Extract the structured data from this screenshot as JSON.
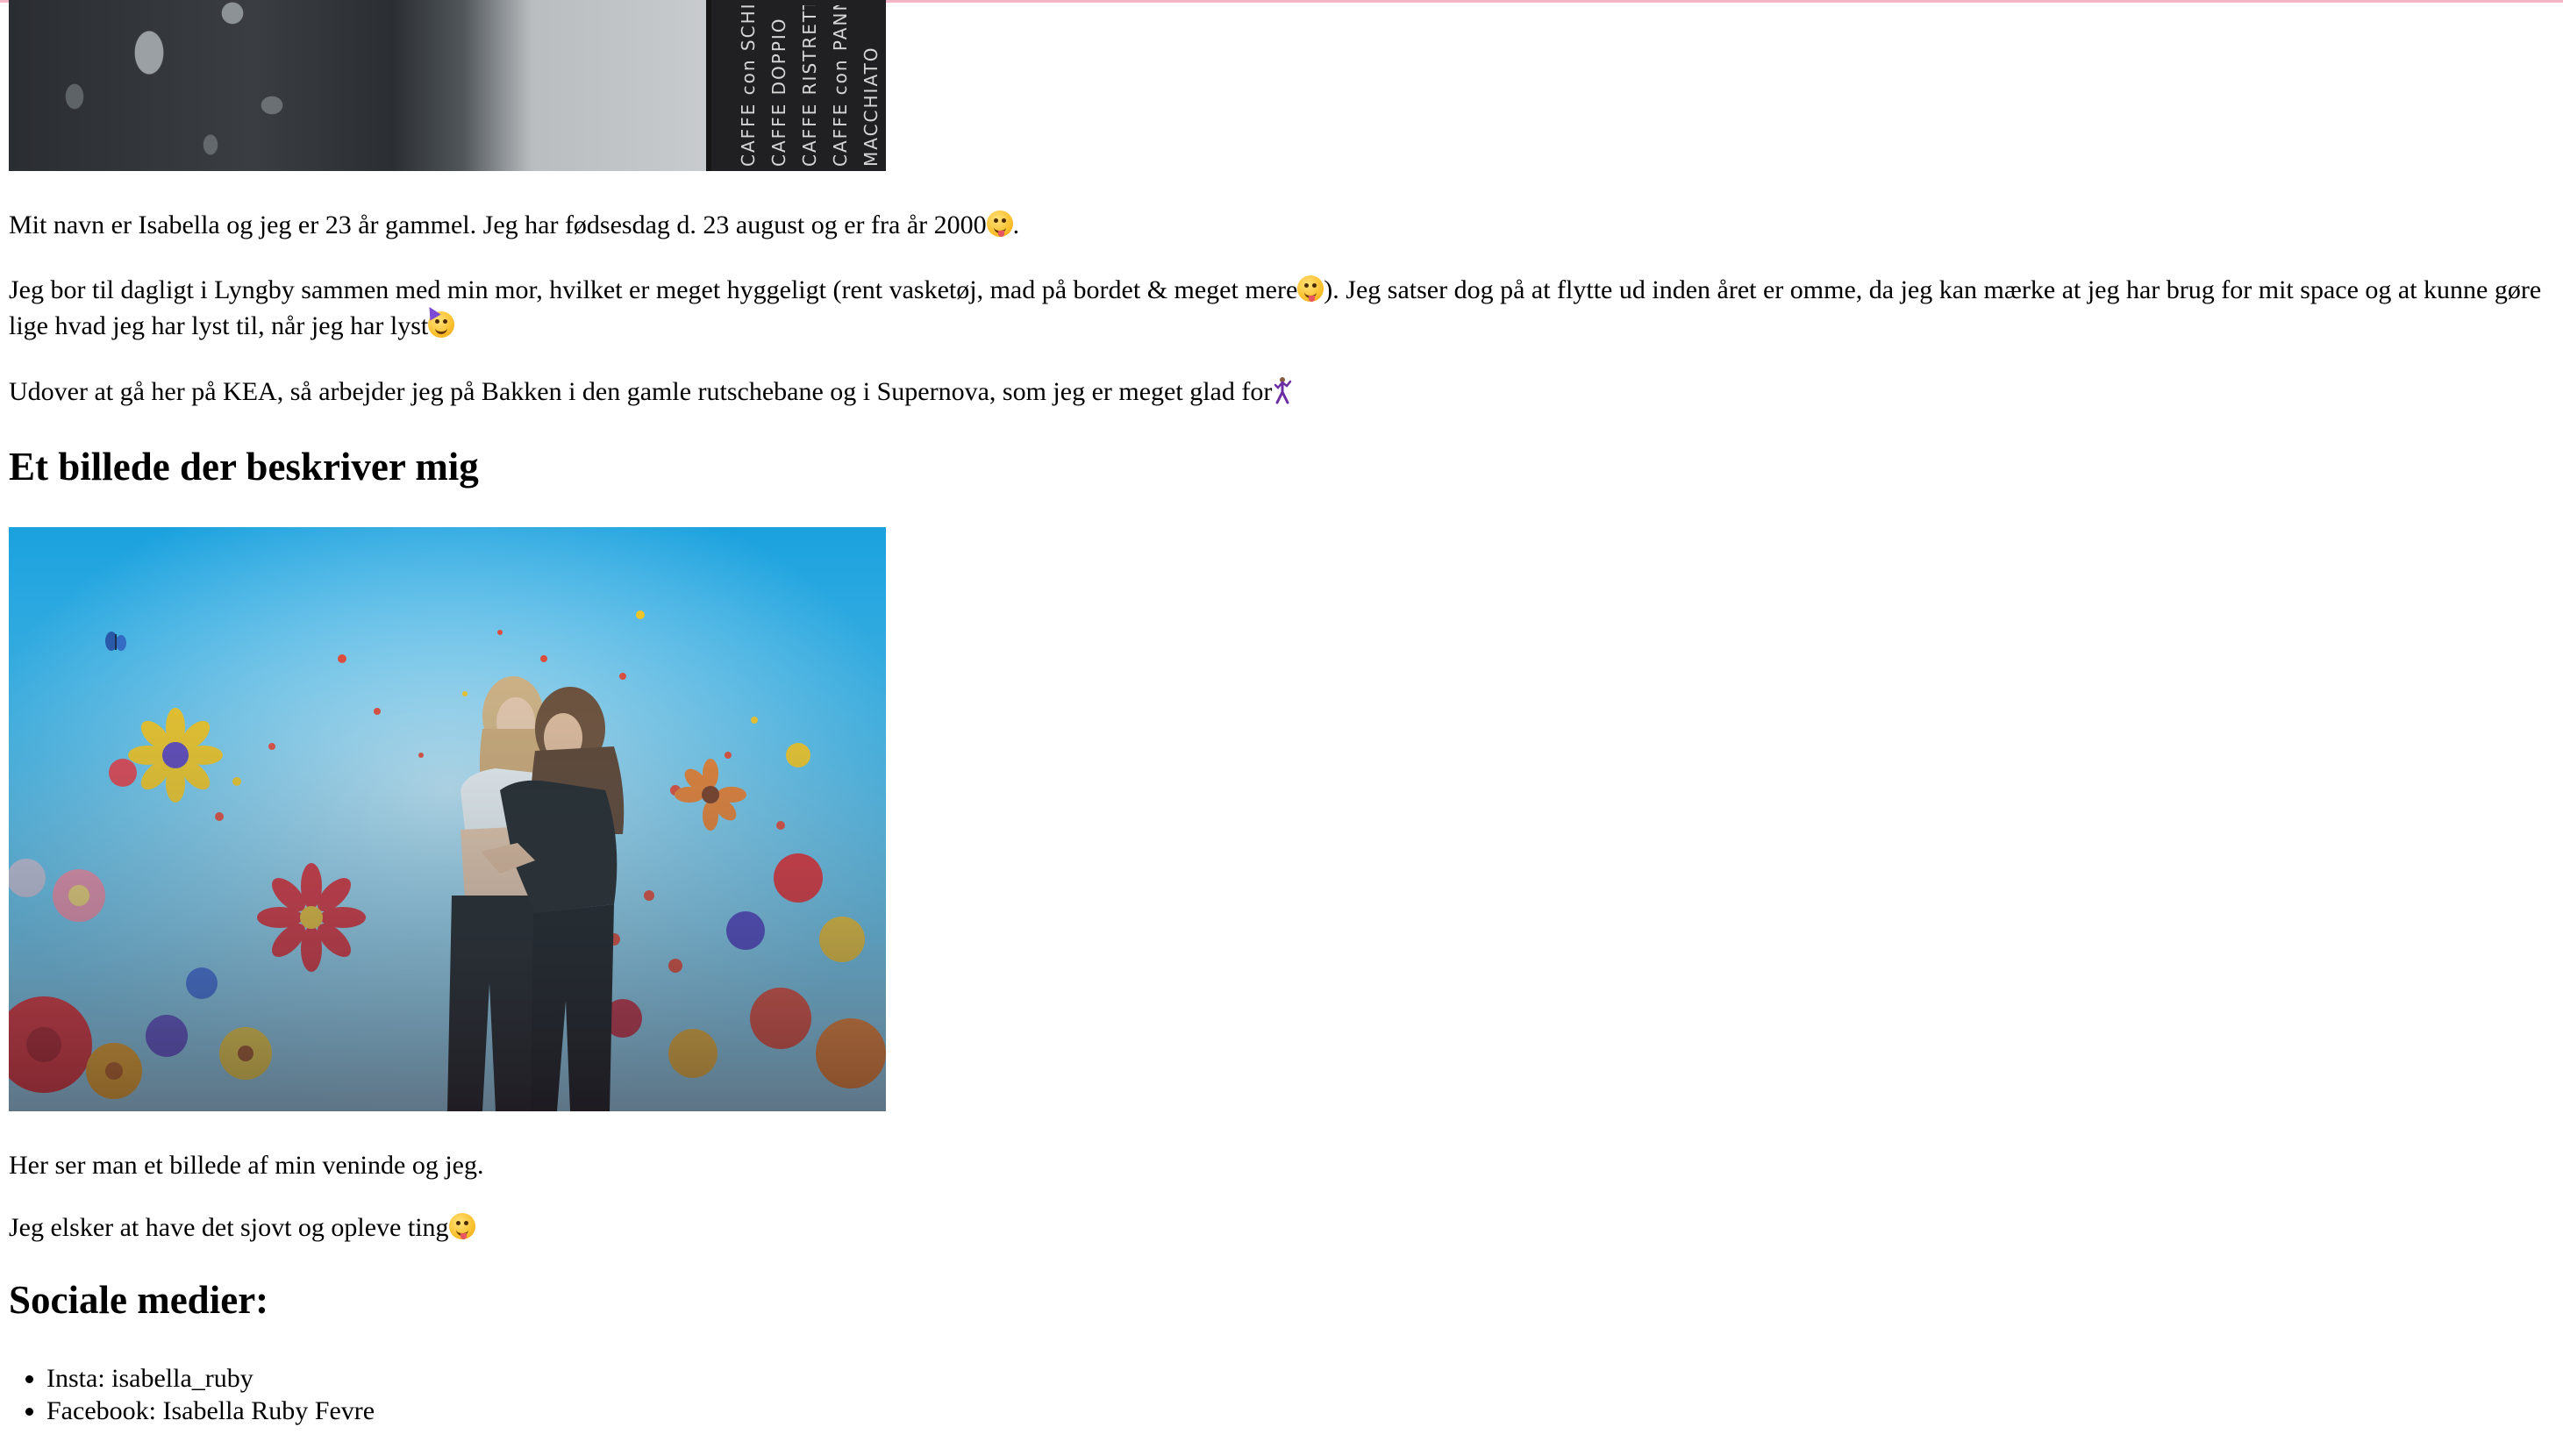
{
  "photo_top": {
    "sign_columns": [
      "MACCHIATO",
      "CAFFE con PANNA",
      "CAFFE RISTRETTO",
      "CAFFE DOPPIO",
      "CAFFE con SCHIUMA"
    ]
  },
  "about": {
    "paragraph_1": "Mit navn er Isabella og jeg er 23 år gammel. Jeg har fødsesdag d. 23 august og er fra år 2000",
    "paragraph_1_end": ".",
    "paragraph_2_a": "Jeg bor til dagligt i Lyngby sammen med min mor, hvilket er meget hyggeligt (rent vasketøj, mad på bordet & meget mere",
    "paragraph_2_b": "). Jeg satser dog på at flytte ud inden året er omme, da jeg kan mærke at jeg har brug for mit space og at kunne gøre lige hvad jeg har lyst til, når jeg har lyst",
    "paragraph_3": "Udover at gå her på KEA, så arbejder jeg på Bakken i den gamle rutschebane og i Supernova, som jeg er meget glad for"
  },
  "describe_section": {
    "heading": "Et billede der beskriver mig",
    "caption": "Her ser man et billede af min veninde og jeg.",
    "text": "Jeg elsker at have det sjovt og opleve ting"
  },
  "social": {
    "heading": "Sociale medier:",
    "items": [
      "Insta: isabella_ruby",
      "Facebook: Isabella Ruby Fevre"
    ]
  },
  "icons": {
    "emoji_1": "zany-face-icon",
    "emoji_2": "zany-face-icon",
    "emoji_3": "partying-face-icon",
    "emoji_4": "dancer-icon",
    "emoji_5": "winking-tongue-face-icon"
  },
  "colors": {
    "top_rule": "#f4b4c8",
    "text": "#000000",
    "background": "#ffffff"
  }
}
